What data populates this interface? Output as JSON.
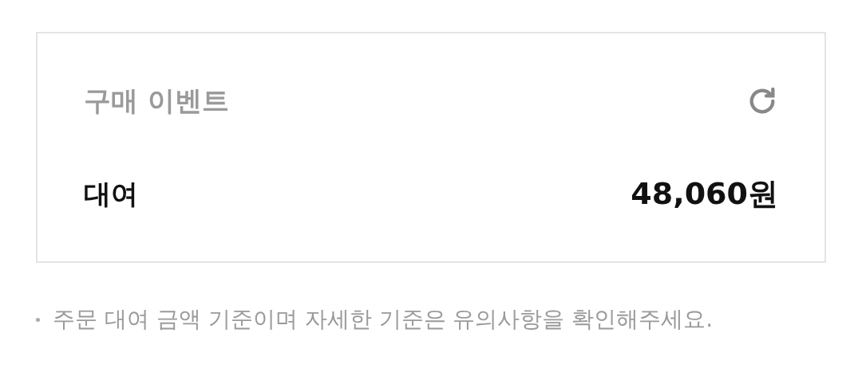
{
  "card": {
    "title": "구매 이벤트",
    "rows": [
      {
        "label": "대여",
        "amount": "48,060원"
      }
    ]
  },
  "notes": [
    "주문 대여 금액 기준이며 자세한 기준은 유의사항을 확인해주세요."
  ]
}
